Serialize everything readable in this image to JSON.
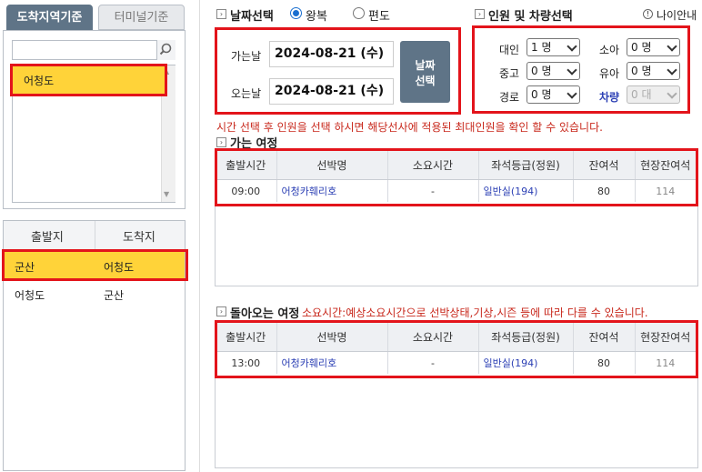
{
  "tabs": {
    "active": "도착지역기준",
    "inactive": "터미널기준"
  },
  "search": {
    "placeholder": ""
  },
  "region_list": {
    "selected": "어청도"
  },
  "routes": {
    "header_from": "출발지",
    "header_to": "도착지",
    "rows": [
      {
        "from": "군산",
        "to": "어청도"
      },
      {
        "from": "어청도",
        "to": "군산"
      }
    ]
  },
  "date_section": {
    "title": "날짜선택",
    "radio_roundtrip": "왕복",
    "radio_oneway": "편도",
    "depart_label": "가는날",
    "depart_value": "2024-08-21 (수)",
    "return_label": "오는날",
    "return_value": "2024-08-21 (수)",
    "select_button_line1": "날짜",
    "select_button_line2": "선택"
  },
  "people_section": {
    "title": "인원 및 차량선택",
    "age_guide": "나이안내",
    "adult_label": "대인",
    "adult_value": "1 명",
    "child_label": "소아",
    "child_value": "0 명",
    "teen_label": "중고",
    "teen_value": "0 명",
    "infant_label": "유아",
    "infant_value": "0 명",
    "senior_label": "경로",
    "senior_value": "0 명",
    "vehicle_label": "차량",
    "vehicle_value": "0 대"
  },
  "notice": "시간 선택 후 인원을 선택 하시면 해당선사에 적용된 최대인원을 확인 할 수 있습니다.",
  "outbound": {
    "title": "가는 여정",
    "columns": [
      "출발시간",
      "선박명",
      "소요시간",
      "좌석등급(정원)",
      "잔여석",
      "현장잔여석"
    ],
    "rows": [
      {
        "time": "09:00",
        "ship": "어청카훼리호",
        "duration": "-",
        "grade": "일반실(194)",
        "remain": "80",
        "onsite": "114"
      }
    ]
  },
  "return": {
    "title": "돌아오는 여정",
    "note": "소요시간:예상소요시간으로 선박상태,기상,시즌 등에 따라 다를 수 있습니다.",
    "columns": [
      "출발시간",
      "선박명",
      "소요시간",
      "좌석등급(정원)",
      "잔여석",
      "현장잔여석"
    ],
    "rows": [
      {
        "time": "13:00",
        "ship": "어청카훼리호",
        "duration": "-",
        "grade": "일반실(194)",
        "remain": "80",
        "onsite": "114"
      }
    ]
  }
}
